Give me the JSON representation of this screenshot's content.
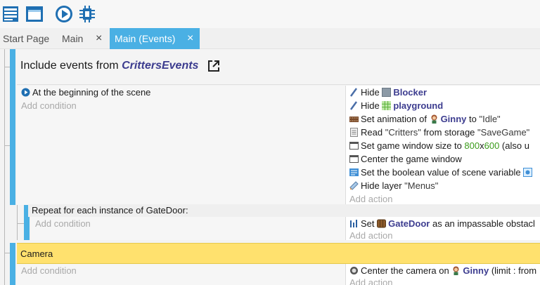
{
  "toolbar": {
    "buttons": [
      {
        "name": "project-manager-icon"
      },
      {
        "name": "scene-window-icon"
      },
      {
        "name": "preview-play-icon"
      },
      {
        "name": "debugger-icon"
      }
    ]
  },
  "tabs": [
    {
      "label": "Start Page",
      "closable": false,
      "active": false
    },
    {
      "label": "Main",
      "closable": true,
      "active": false
    },
    {
      "label": "Main (Events)",
      "closable": true,
      "active": true
    }
  ],
  "tab_close_glyph": "×",
  "events": {
    "include": {
      "prefix": "Include events from ",
      "name": "CrittersEvents"
    },
    "scene_start": {
      "condition": "At the beginning of the scene",
      "add_condition": "Add condition",
      "actions": [
        {
          "prefix": "Hide ",
          "object": "Blocker",
          "suffix": ""
        },
        {
          "prefix": "Hide ",
          "object": "playground",
          "suffix": ""
        },
        {
          "prefix": "Set animation of ",
          "object": "Ginny",
          "mid": " to ",
          "value": "\"Idle\""
        },
        {
          "prefix": "Read ",
          "value1": "\"Critters\"",
          "mid": " from storage ",
          "value2": "\"SaveGame\""
        },
        {
          "prefix": "Set game window size to ",
          "w": "800",
          "x": "x",
          "h": "600",
          "suffix": " (also u"
        },
        {
          "text": "Center the game window"
        },
        {
          "text": "Set the boolean value of scene variable "
        },
        {
          "prefix": "Hide layer ",
          "value": "\"Menus\""
        }
      ],
      "add_action": "Add action"
    },
    "repeat": {
      "label": "Repeat for each instance of GateDoor:",
      "add_condition": "Add condition",
      "action": {
        "prefix": "Set ",
        "object": "GateDoor",
        "suffix": " as an impassable obstacl"
      },
      "add_action": "Add action"
    },
    "camera": {
      "label": "Camera"
    },
    "camera_event": {
      "add_condition": "Add condition",
      "action": {
        "prefix": "Center the camera on ",
        "object": "Ginny",
        "suffix": " (limit : from"
      },
      "add_action": "Add action"
    }
  },
  "colors": {
    "accent": "#4ab0e4",
    "object_name": "#3c3c8f",
    "number": "#3b9c1b",
    "group_bar": "#ffe16e",
    "placeholder": "#a9a9a9"
  }
}
